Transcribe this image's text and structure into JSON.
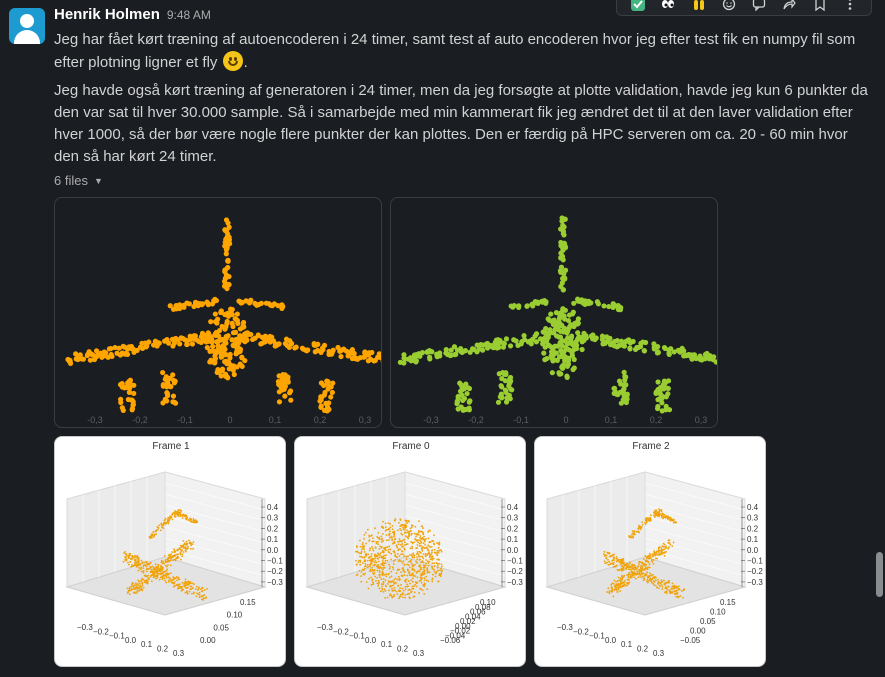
{
  "message": {
    "sender": "Henrik Holmen",
    "time": "9:48 AM",
    "paragraph1_before_emoji": "Jeg har fået kørt træning af autoencoderen i 24 timer, samt test af auto encoderen hvor jeg efter test fik en numpy fil som efter plotning ligner et fly",
    "paragraph1_after_emoji": ".",
    "emoji": "slightly-smiling-face",
    "paragraph2": "Jeg havde også kørt træning af generatoren i 24 timer, men da jeg forsøgte at plotte validation, havde jeg kun 6 punkter da den var sat til hver 30.000 sample. Så i samarbejde med min kammerart fik jeg ændret det til at den laver validation efter hver 1000, så der bør være nogle flere punkter der kan plottes. Den er færdig på HPC serveren om ca. 20 - 60 min hvor den så har kørt 24 timer."
  },
  "files": {
    "toggle_label": "6 files",
    "caret": "▼",
    "count": 6
  },
  "toolbar": {
    "actions": [
      "check-mark-reaction",
      "eyes-reaction",
      "raised-hands-reaction",
      "add-reaction",
      "reply-in-thread",
      "share-message",
      "save-message",
      "more-actions"
    ]
  },
  "colors": {
    "orange_points": "#ffa500",
    "green_points": "#9acd32",
    "slack_bg": "#1a1d21"
  },
  "attachments": {
    "top": [
      {
        "name": "orange-airplane-plot",
        "color": "#ffa500",
        "x_ticks": [
          "-0,3",
          "-0,2",
          "-0,1",
          "0",
          "0,1",
          "0,2",
          "0,3"
        ]
      },
      {
        "name": "green-airplane-plot",
        "color": "#9acd32",
        "x_ticks": [
          "-0,3",
          "-0,2",
          "-0,1",
          "0",
          "0,1",
          "0,2",
          "0,3"
        ]
      }
    ],
    "frames": [
      {
        "title": "Frame 1",
        "z_ticks": [
          "0.4",
          "0.3",
          "0.2",
          "0.1",
          "0.0",
          "−0.1",
          "−0.2",
          "−0.3"
        ],
        "y_ticks": [
          "0.15",
          "0.10",
          "0.05",
          "0.00"
        ],
        "x_ticks": [
          "−0.3",
          "−0.2",
          "−0.1",
          "0.0",
          "0.1",
          "0.2",
          "0.3"
        ]
      },
      {
        "title": "Frame 0",
        "z_ticks": [
          "0.4",
          "0.3",
          "0.2",
          "0.1",
          "0.0",
          "−0.1",
          "−0.2",
          "−0.3"
        ],
        "y_ticks": [
          "0.10",
          "0.08",
          "0.06",
          "0.04",
          "0.02",
          "0.00",
          "−0.02",
          "−0.04",
          "−0.06"
        ],
        "x_ticks": [
          "−0.3",
          "−0.2",
          "−0.1",
          "0.0",
          "0.1",
          "0.2",
          "0.3"
        ]
      },
      {
        "title": "Frame 2",
        "z_ticks": [
          "0.4",
          "0.3",
          "0.2",
          "0.1",
          "0.0",
          "−0.1",
          "−0.2",
          "−0.3"
        ],
        "y_ticks": [
          "0.15",
          "0.10",
          "0.05",
          "0.00",
          "−0.05"
        ],
        "x_ticks": [
          "−0.3",
          "−0.2",
          "−0.1",
          "0.0",
          "0.1",
          "0.2",
          "0.3"
        ]
      }
    ]
  }
}
